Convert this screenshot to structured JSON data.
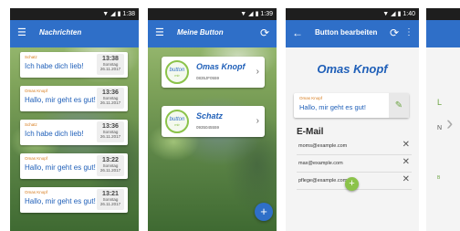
{
  "status": {
    "p1_time": "1:38",
    "p2_time": "1:39",
    "p3_time": "1:40"
  },
  "screen1": {
    "title": "Nachrichten",
    "messages": [
      {
        "from": "Schatz",
        "text": "Ich habe dich lieb!",
        "time": "13:38",
        "day": "Sonntag",
        "date": "26.11.2017"
      },
      {
        "from": "Omas Knopf",
        "text": "Hallo, mir geht es gut!",
        "time": "13:36",
        "day": "Sonntag",
        "date": "26.11.2017"
      },
      {
        "from": "Schatz",
        "text": "Ich habe dich lieb!",
        "time": "13:36",
        "day": "Sonntag",
        "date": "26.11.2017"
      },
      {
        "from": "Omas Knopf",
        "text": "Hallo, mir geht es gut!",
        "time": "13:22",
        "day": "Sonntag",
        "date": "26.11.2017"
      },
      {
        "from": "Omas Knopf",
        "text": "Hallo, mir geht es gut!",
        "time": "13:21",
        "day": "Sonntag",
        "date": "26.11.2017"
      }
    ]
  },
  "screen2": {
    "title": "Meine Button",
    "logo_line1": "button",
    "logo_line2": "mir",
    "buttons": [
      {
        "name": "Omas Knopf",
        "serial": "0835JF0559"
      },
      {
        "name": "Schatz",
        "serial": "0935045559"
      }
    ],
    "fab_label": "+"
  },
  "screen3": {
    "title": "Button bearbeiten",
    "heading": "Omas Knopf",
    "message_from": "Omas Knopf",
    "message_text": "Hallo, mir geht es gut!",
    "email_title": "E-Mail",
    "emails": [
      "moms@example.com",
      "max@example.com",
      "pflege@example.com"
    ],
    "add_label": "+"
  },
  "screen4": {
    "frag1": "L",
    "frag2": "N",
    "frag3": "B"
  },
  "icons": {
    "menu": "menu-icon",
    "refresh": "refresh-icon",
    "back": "back-arrow-icon",
    "more": "more-vert-icon",
    "chevron": "chevron-right-icon",
    "close": "close-icon",
    "edit": "pencil-icon",
    "next": "chevron-right-icon"
  },
  "colors": {
    "primary": "#2f6fc8",
    "accent": "#8bc34a",
    "sender": "#d67a1a"
  }
}
